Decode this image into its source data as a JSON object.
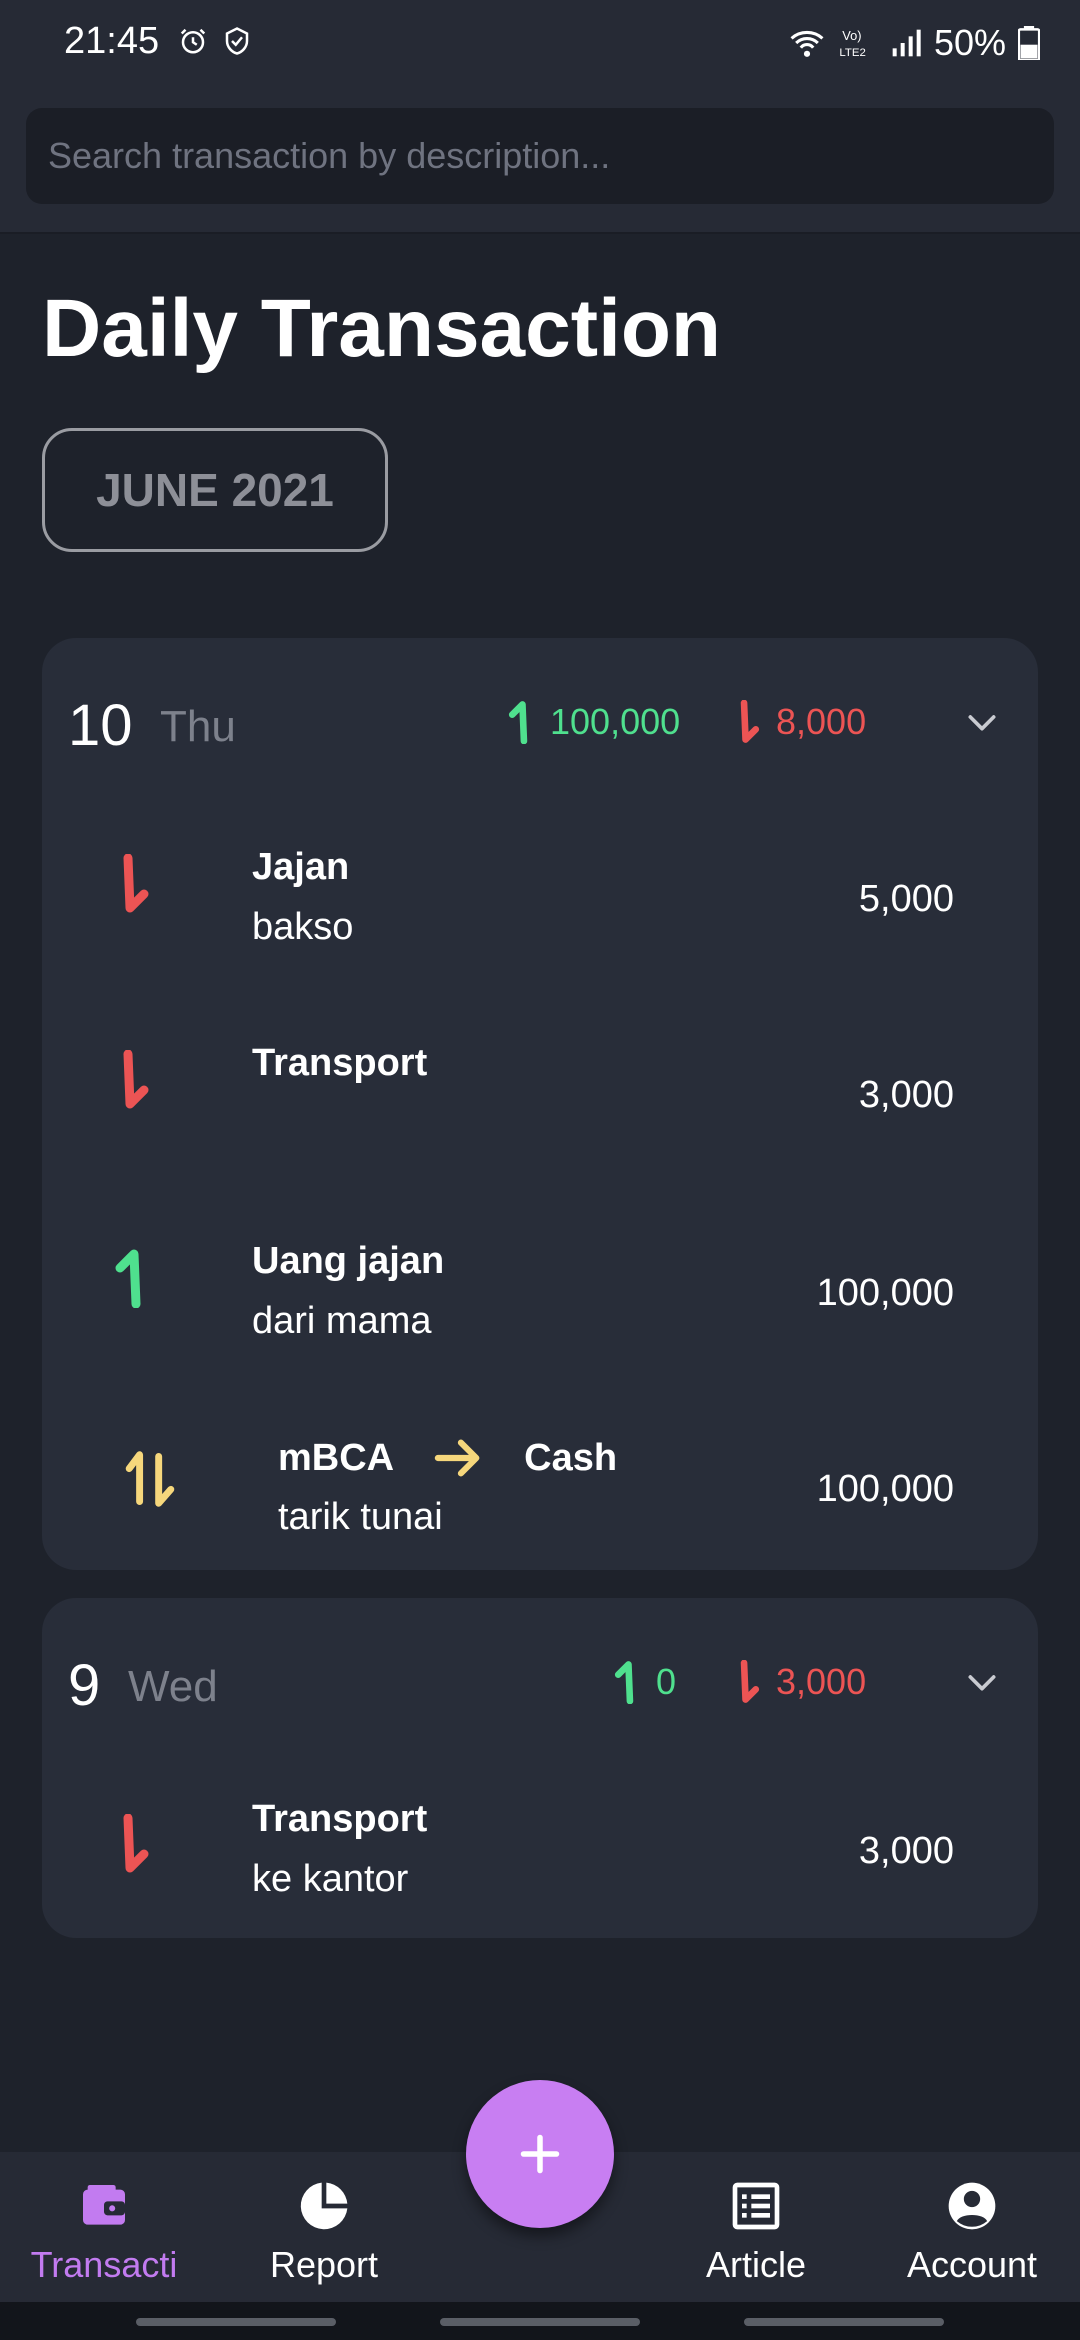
{
  "status_bar": {
    "time": "21:45",
    "battery": "50%",
    "icons": [
      "alarm-icon",
      "shield-icon",
      "wifi-icon",
      "volte-icon",
      "signal-icon",
      "battery-icon"
    ]
  },
  "search": {
    "placeholder": "Search transaction by description..."
  },
  "page": {
    "title": "Daily Transaction",
    "month_label": "JUNE 2021"
  },
  "colors": {
    "income": "#4fe08e",
    "expense": "#ec5454",
    "transfer": "#f6d77c",
    "accent": "#c87ef2"
  },
  "days": [
    {
      "day": "10",
      "weekday": "Thu",
      "income_total": "100,000",
      "expense_total": "8,000",
      "transactions": [
        {
          "type": "expense",
          "category": "Jajan",
          "description": "bakso",
          "amount": "5,000"
        },
        {
          "type": "expense",
          "category": "Transport",
          "description": "",
          "amount": "3,000"
        },
        {
          "type": "income",
          "category": "Uang jajan",
          "description": "dari mama",
          "amount": "100,000"
        },
        {
          "type": "transfer",
          "from": "mBCA",
          "to": "Cash",
          "description": "tarik tunai",
          "amount": "100,000"
        }
      ]
    },
    {
      "day": "9",
      "weekday": "Wed",
      "income_total": "0",
      "expense_total": "3,000",
      "transactions": [
        {
          "type": "expense",
          "category": "Transport",
          "description": "ke kantor",
          "amount": "3,000"
        }
      ]
    }
  ],
  "nav": {
    "items": [
      {
        "label": "Transacti",
        "icon": "wallet-icon",
        "active": true
      },
      {
        "label": "Report",
        "icon": "pie-chart-icon",
        "active": false
      },
      {
        "label": "Article",
        "icon": "article-icon",
        "active": false
      },
      {
        "label": "Account",
        "icon": "account-icon",
        "active": false
      }
    ],
    "fab_icon": "plus-icon"
  }
}
